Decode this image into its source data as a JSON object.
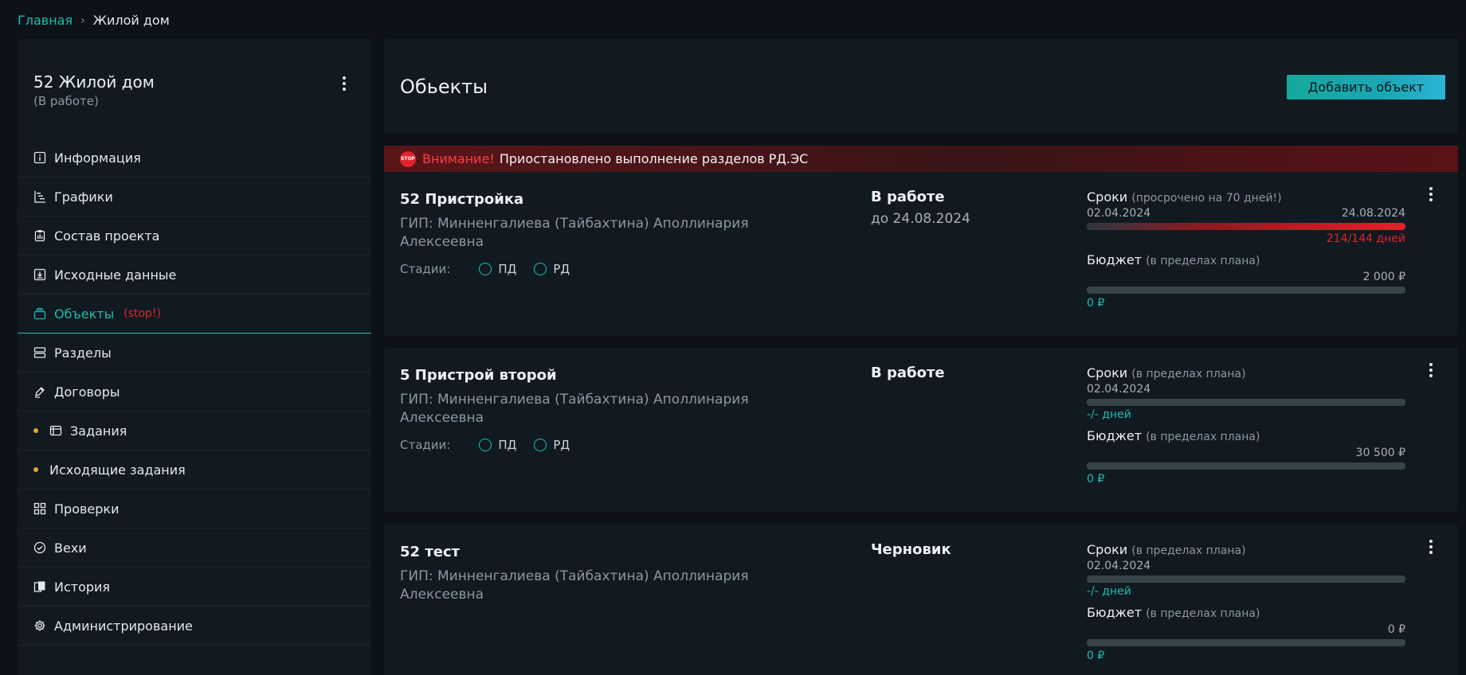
{
  "breadcrumb": {
    "home": "Главная",
    "separator": "›",
    "current": "Жилой дом"
  },
  "project": {
    "title": "52 Жилой дом",
    "status": "(В работе)"
  },
  "sidebar": {
    "items": [
      {
        "label": "Информация",
        "icon": "info-icon"
      },
      {
        "label": "Графики",
        "icon": "gantt-icon"
      },
      {
        "label": "Состав проекта",
        "icon": "clipboard-icon"
      },
      {
        "label": "Исходные данные",
        "icon": "download-icon"
      },
      {
        "label": "Объекты",
        "icon": "stack-icon",
        "active": true,
        "badge": "(stop!)"
      },
      {
        "label": "Разделы",
        "icon": "sections-icon"
      },
      {
        "label": "Договоры",
        "icon": "pen-icon"
      },
      {
        "label": "Задания",
        "icon": "tasks-icon",
        "dot": true
      },
      {
        "label": "Исходящие задания",
        "dot": true
      },
      {
        "label": "Проверки",
        "icon": "grid-check-icon"
      },
      {
        "label": "Вехи",
        "icon": "check-circle-icon"
      },
      {
        "label": "История",
        "icon": "history-icon"
      },
      {
        "label": "Администрирование",
        "icon": "gear-icon"
      }
    ]
  },
  "main": {
    "title": "Обьекты",
    "add_button": "Добавить объект",
    "warning": {
      "title": "Внимание!",
      "text": "Приостановлено выполнение разделов РД.ЭС",
      "icon_text": "STOP"
    }
  },
  "objects": [
    {
      "name": "52 Пристройка",
      "gip": "ГИП: Минненгалиева (Тайбахтина) Аполлинария Алексеевна",
      "stages_label": "Стадии:",
      "stages": [
        "ПД",
        "РД"
      ],
      "status": "В работе",
      "deadline": "до 24.08.2024",
      "terms_title": "Сроки",
      "terms_note": "(просрочено на 70 дней!)",
      "date_start": "02.04.2024",
      "date_end": "24.08.2024",
      "terms_progress": 1.0,
      "days": "214/144 дней",
      "budget_title": "Бюджет",
      "budget_note": "(в пределах плана)",
      "budget_total": "2 000 ₽",
      "budget_progress": 0,
      "budget_spent": "0 ₽"
    },
    {
      "name": "5 Пристрой второй",
      "gip": "ГИП: Минненгалиева (Тайбахтина) Аполлинария Алексеевна",
      "stages_label": "Стадии:",
      "stages": [
        "ПД",
        "РД"
      ],
      "status": "В работе",
      "terms_title": "Сроки",
      "terms_note": "(в пределах плана)",
      "date_start": "02.04.2024",
      "terms_progress": 0,
      "days": "-/- дней",
      "budget_title": "Бюджет",
      "budget_note": "(в пределах плана)",
      "budget_total": "30 500 ₽",
      "budget_progress": 0,
      "budget_spent": "0 ₽"
    },
    {
      "name": "52 тест",
      "gip": "ГИП: Минненгалиева (Тайбахтина) Аполлинария Алексеевна",
      "status": "Черновик",
      "terms_title": "Сроки",
      "terms_note": "(в пределах плана)",
      "date_start": "02.04.2024",
      "terms_progress": 0,
      "days": "-/- дней",
      "budget_title": "Бюджет",
      "budget_note": "(в пределах плана)",
      "budget_total": "0 ₽",
      "budget_progress": 0,
      "budget_spent": "0 ₽"
    }
  ],
  "colors": {
    "accent": "#1fbcae",
    "danger": "#e0232b",
    "dot": "#e6a530",
    "background": "#0c1218",
    "card": "#111a21"
  }
}
